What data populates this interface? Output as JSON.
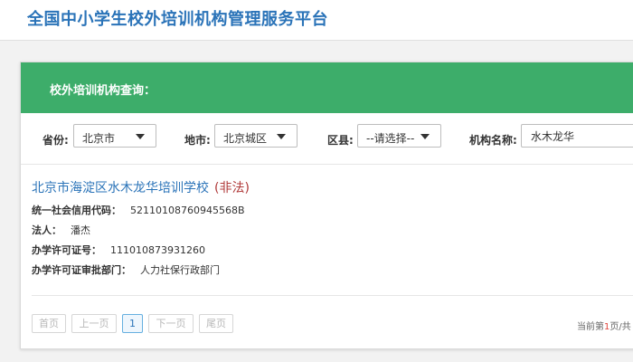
{
  "header": {
    "title": "全国中小学生校外培训机构管理服务平台"
  },
  "panel": {
    "title": "校外培训机构查询：",
    "filters": {
      "province": {
        "label": "省份:",
        "value": "北京市"
      },
      "city": {
        "label": "地市:",
        "value": "北京城区"
      },
      "district": {
        "label": "区县:",
        "value": "--请选择--"
      },
      "org_name": {
        "label": "机构名称:",
        "value": "水木龙华"
      }
    }
  },
  "result": {
    "name": "北京市海淀区水木龙华培训学校",
    "status": "(非法)",
    "credit_code_label": "统一社会信用代码：",
    "credit_code": "52110108760945568B",
    "legal_person_label": "法人：",
    "legal_person": "潘杰",
    "license_no_label": "办学许可证号：",
    "license_no": "111010873931260",
    "approval_dept_label": "办学许可证审批部门：",
    "approval_dept": "人力社保行政部门"
  },
  "pagination": {
    "first": "首页",
    "prev": "上一页",
    "current": "1",
    "next": "下一页",
    "last": "尾页",
    "info_prefix": "当前第",
    "info_page": "1",
    "info_suffix": "页/共"
  },
  "colors": {
    "brand_blue": "#2a73b8",
    "header_green": "#3dad6a",
    "status_red": "#b03a3a"
  }
}
